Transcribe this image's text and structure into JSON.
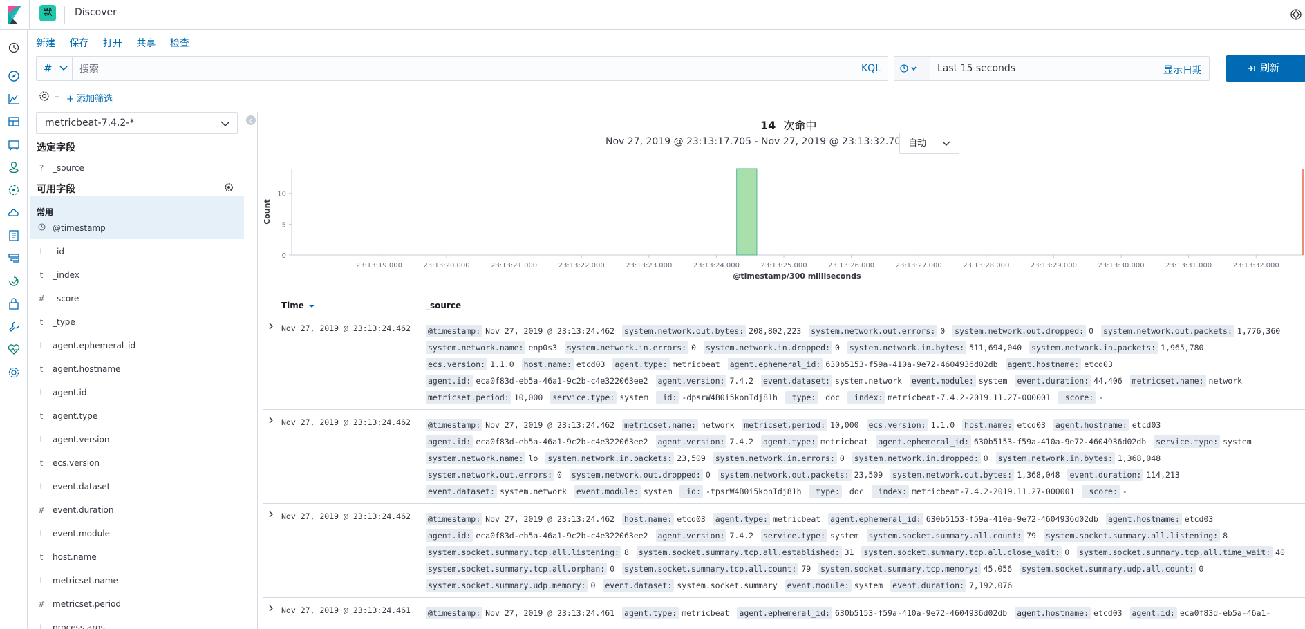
{
  "header": {
    "app_title": "Discover",
    "space_initial": "默"
  },
  "topnav": [
    "新建",
    "保存",
    "打开",
    "共享",
    "检查"
  ],
  "query": {
    "lang_label": "#",
    "placeholder": "搜索",
    "value": "",
    "kql_label": "KQL"
  },
  "time": {
    "range": "Last 15 seconds",
    "show_dates": "显示日期",
    "refresh": "刷新"
  },
  "filter": {
    "add_label": "+ 添加筛选"
  },
  "sidebar": {
    "index_pattern": "metricbeat-7.4.2-*",
    "selected_title": "选定字段",
    "selected_fields": [
      {
        "type": "?",
        "name": "_source"
      }
    ],
    "available_title": "可用字段",
    "common_label": "常用",
    "common_fields": [
      {
        "type": "clock",
        "name": "@timestamp"
      }
    ],
    "fields": [
      {
        "type": "t",
        "name": "_id"
      },
      {
        "type": "t",
        "name": "_index"
      },
      {
        "type": "#",
        "name": "_score"
      },
      {
        "type": "t",
        "name": "_type"
      },
      {
        "type": "t",
        "name": "agent.ephemeral_id"
      },
      {
        "type": "t",
        "name": "agent.hostname"
      },
      {
        "type": "t",
        "name": "agent.id"
      },
      {
        "type": "t",
        "name": "agent.type"
      },
      {
        "type": "t",
        "name": "agent.version"
      },
      {
        "type": "t",
        "name": "ecs.version"
      },
      {
        "type": "t",
        "name": "event.dataset"
      },
      {
        "type": "#",
        "name": "event.duration"
      },
      {
        "type": "t",
        "name": "event.module"
      },
      {
        "type": "t",
        "name": "host.name"
      },
      {
        "type": "t",
        "name": "metricset.name"
      },
      {
        "type": "#",
        "name": "metricset.period"
      },
      {
        "type": "t",
        "name": "process.args"
      }
    ]
  },
  "summary": {
    "hit_count": "14",
    "hit_label": "次命中",
    "range_text": "Nov 27, 2019 @ 23:13:17.705 - Nov 27, 2019 @ 23:13:32.705 —",
    "interval": "自动"
  },
  "chart_data": {
    "type": "bar",
    "ylabel": "Count",
    "xlabel": "@timestamp/300 milliseconds",
    "ylim": [
      0,
      14
    ],
    "yticks": [
      0,
      5,
      10
    ],
    "xticks": [
      "23:13:19.000",
      "23:13:20.000",
      "23:13:21.000",
      "23:13:22.000",
      "23:13:23.000",
      "23:13:24.000",
      "23:13:25.000",
      "23:13:26.000",
      "23:13:27.000",
      "23:13:28.000",
      "23:13:29.000",
      "23:13:30.000",
      "23:13:31.000",
      "23:13:32.000"
    ],
    "x_start_s": 17.705,
    "x_end_s": 32.705,
    "bars": [
      {
        "x_start_s": 24.3,
        "x_end_s": 24.6,
        "value": 14
      }
    ],
    "now_marker_s": 32.705,
    "bar_color": "#a8dfaa",
    "bar_stroke": "#54b399",
    "marker_color": "#e7664c"
  },
  "table": {
    "time_header": "Time",
    "source_header": "_source",
    "rows": [
      {
        "time": "Nov 27, 2019 @ 23:13:24.462",
        "fields": [
          [
            "@timestamp:",
            "Nov 27, 2019 @ 23:13:24.462"
          ],
          [
            "system.network.out.bytes:",
            "208,802,223"
          ],
          [
            "system.network.out.errors:",
            "0"
          ],
          [
            "system.network.out.dropped:",
            "0"
          ],
          [
            "system.network.out.packets:",
            "1,776,360"
          ],
          [
            "system.network.name:",
            "enp0s3"
          ],
          [
            "system.network.in.errors:",
            "0"
          ],
          [
            "system.network.in.dropped:",
            "0"
          ],
          [
            "system.network.in.bytes:",
            "511,694,040"
          ],
          [
            "system.network.in.packets:",
            "1,965,780"
          ],
          [
            "ecs.version:",
            "1.1.0"
          ],
          [
            "host.name:",
            "etcd03"
          ],
          [
            "agent.type:",
            "metricbeat"
          ],
          [
            "agent.ephemeral_id:",
            "630b5153-f59a-410a-9e72-4604936d02db"
          ],
          [
            "agent.hostname:",
            "etcd03"
          ],
          [
            "agent.id:",
            "eca0f83d-eb5a-46a1-9c2b-c4e322063ee2"
          ],
          [
            "agent.version:",
            "7.4.2"
          ],
          [
            "event.dataset:",
            "system.network"
          ],
          [
            "event.module:",
            "system"
          ],
          [
            "event.duration:",
            "44,406"
          ],
          [
            "metricset.name:",
            "network"
          ],
          [
            "metricset.period:",
            "10,000"
          ],
          [
            "service.type:",
            "system"
          ],
          [
            "_id:",
            "-dpsrW4B0i5konIdj81h"
          ],
          [
            "_type:",
            "_doc"
          ],
          [
            "_index:",
            "metricbeat-7.4.2-2019.11.27-000001"
          ],
          [
            "_score:",
            "-"
          ]
        ]
      },
      {
        "time": "Nov 27, 2019 @ 23:13:24.462",
        "fields": [
          [
            "@timestamp:",
            "Nov 27, 2019 @ 23:13:24.462"
          ],
          [
            "metricset.name:",
            "network"
          ],
          [
            "metricset.period:",
            "10,000"
          ],
          [
            "ecs.version:",
            "1.1.0"
          ],
          [
            "host.name:",
            "etcd03"
          ],
          [
            "agent.hostname:",
            "etcd03"
          ],
          [
            "agent.id:",
            "eca0f83d-eb5a-46a1-9c2b-c4e322063ee2"
          ],
          [
            "agent.version:",
            "7.4.2"
          ],
          [
            "agent.type:",
            "metricbeat"
          ],
          [
            "agent.ephemeral_id:",
            "630b5153-f59a-410a-9e72-4604936d02db"
          ],
          [
            "service.type:",
            "system"
          ],
          [
            "system.network.name:",
            "lo"
          ],
          [
            "system.network.in.packets:",
            "23,509"
          ],
          [
            "system.network.in.errors:",
            "0"
          ],
          [
            "system.network.in.dropped:",
            "0"
          ],
          [
            "system.network.in.bytes:",
            "1,368,048"
          ],
          [
            "system.network.out.errors:",
            "0"
          ],
          [
            "system.network.out.dropped:",
            "0"
          ],
          [
            "system.network.out.packets:",
            "23,509"
          ],
          [
            "system.network.out.bytes:",
            "1,368,048"
          ],
          [
            "event.duration:",
            "114,213"
          ],
          [
            "event.dataset:",
            "system.network"
          ],
          [
            "event.module:",
            "system"
          ],
          [
            "_id:",
            "-tpsrW4B0i5konIdj81h"
          ],
          [
            "_type:",
            "_doc"
          ],
          [
            "_index:",
            "metricbeat-7.4.2-2019.11.27-000001"
          ],
          [
            "_score:",
            "-"
          ]
        ]
      },
      {
        "time": "Nov 27, 2019 @ 23:13:24.462",
        "fields": [
          [
            "@timestamp:",
            "Nov 27, 2019 @ 23:13:24.462"
          ],
          [
            "host.name:",
            "etcd03"
          ],
          [
            "agent.type:",
            "metricbeat"
          ],
          [
            "agent.ephemeral_id:",
            "630b5153-f59a-410a-9e72-4604936d02db"
          ],
          [
            "agent.hostname:",
            "etcd03"
          ],
          [
            "agent.id:",
            "eca0f83d-eb5a-46a1-9c2b-c4e322063ee2"
          ],
          [
            "agent.version:",
            "7.4.2"
          ],
          [
            "service.type:",
            "system"
          ],
          [
            "system.socket.summary.all.count:",
            "79"
          ],
          [
            "system.socket.summary.all.listening:",
            "8"
          ],
          [
            "system.socket.summary.tcp.all.listening:",
            "8"
          ],
          [
            "system.socket.summary.tcp.all.established:",
            "31"
          ],
          [
            "system.socket.summary.tcp.all.close_wait:",
            "0"
          ],
          [
            "system.socket.summary.tcp.all.time_wait:",
            "40"
          ],
          [
            "system.socket.summary.tcp.all.orphan:",
            "0"
          ],
          [
            "system.socket.summary.tcp.all.count:",
            "79"
          ],
          [
            "system.socket.summary.tcp.memory:",
            "45,056"
          ],
          [
            "system.socket.summary.udp.all.count:",
            "0"
          ],
          [
            "system.socket.summary.udp.memory:",
            "0"
          ],
          [
            "event.dataset:",
            "system.socket.summary"
          ],
          [
            "event.module:",
            "system"
          ],
          [
            "event.duration:",
            "7,192,076"
          ]
        ]
      },
      {
        "time": "Nov 27, 2019 @ 23:13:24.461",
        "fields": [
          [
            "@timestamp:",
            "Nov 27, 2019 @ 23:13:24.461"
          ],
          [
            "agent.type:",
            "metricbeat"
          ],
          [
            "agent.ephemeral_id:",
            "630b5153-f59a-410a-9e72-4604936d02db"
          ],
          [
            "agent.hostname:",
            "etcd03"
          ],
          [
            "agent.id:",
            "eca0f83d-eb5a-46a1-"
          ]
        ]
      }
    ]
  },
  "colors": {
    "accent": "#006bb4",
    "bar": "#a8dfaa",
    "highlight_row": "#e6f0f8"
  }
}
